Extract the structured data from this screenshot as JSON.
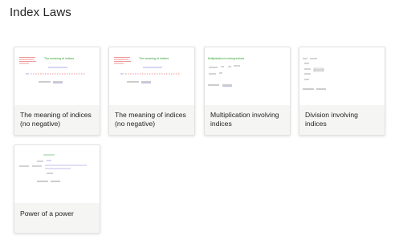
{
  "page": {
    "title": "Index Laws"
  },
  "colors": {
    "green": "#2e9e2e",
    "red": "#e0302f",
    "blue": "#5560d6",
    "grey": "#8a8a8a",
    "footer_bg": "#f5f5f4"
  },
  "cards": [
    {
      "title": "The meaning of indices (no negative)",
      "thumb_heading": "The meaning of indices"
    },
    {
      "title": "The meaning of indices (no negative)",
      "thumb_heading": "The meaning of indices"
    },
    {
      "title": "Multiplication involving indices",
      "thumb_heading": "Multiplication involving indices"
    },
    {
      "title": "Division involving indices",
      "thumb_heading": ""
    },
    {
      "title": "Power of a power",
      "thumb_heading": ""
    }
  ]
}
